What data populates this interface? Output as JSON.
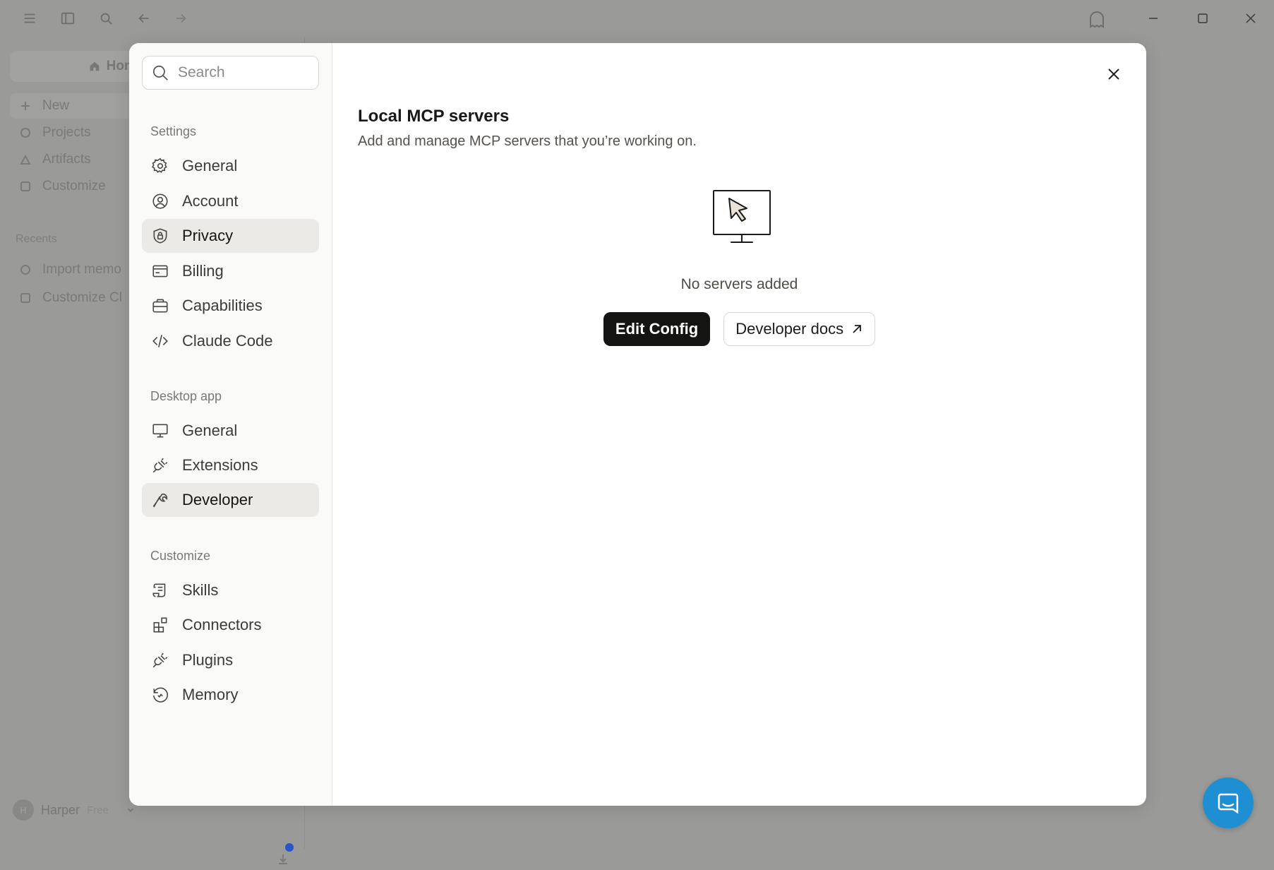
{
  "background": {
    "sidebar": {
      "home_label": "Home",
      "items": [
        {
          "label": "New",
          "icon": "plus-icon"
        },
        {
          "label": "Projects",
          "icon": "folder-icon"
        },
        {
          "label": "Artifacts",
          "icon": "artifacts-icon"
        },
        {
          "label": "Customize",
          "icon": "customize-icon"
        }
      ],
      "recents_label": "Recents",
      "recents": [
        {
          "label": "Import memo",
          "icon": "chat-icon"
        },
        {
          "label": "Customize Cl",
          "icon": "chat-icon"
        }
      ],
      "user": {
        "initial": "H",
        "name": "Harper",
        "plan": "Free"
      }
    }
  },
  "settings": {
    "search": {
      "placeholder": "Search"
    },
    "groups": [
      {
        "label": "Settings",
        "items": [
          {
            "label": "General",
            "icon": "gear-icon",
            "active": false
          },
          {
            "label": "Account",
            "icon": "user-circle-icon",
            "active": false
          },
          {
            "label": "Privacy",
            "icon": "shield-lock-icon",
            "active": false
          },
          {
            "label": "Billing",
            "icon": "credit-card-icon",
            "active": false
          },
          {
            "label": "Capabilities",
            "icon": "briefcase-icon",
            "active": false
          },
          {
            "label": "Claude Code",
            "icon": "code-icon",
            "active": false
          }
        ]
      },
      {
        "label": "Desktop app",
        "items": [
          {
            "label": "General",
            "icon": "monitor-icon",
            "active": false
          },
          {
            "label": "Extensions",
            "icon": "plug-icon",
            "active": false
          },
          {
            "label": "Developer",
            "icon": "wrench-icon",
            "active": true
          }
        ]
      },
      {
        "label": "Customize",
        "items": [
          {
            "label": "Skills",
            "icon": "scroll-icon",
            "active": false
          },
          {
            "label": "Connectors",
            "icon": "grid-plus-icon",
            "active": false
          },
          {
            "label": "Plugins",
            "icon": "plug-icon",
            "active": false
          },
          {
            "label": "Memory",
            "icon": "memory-icon",
            "active": false
          }
        ]
      }
    ],
    "content": {
      "title": "Local MCP servers",
      "subtitle": "Add and manage MCP servers that you’re working on.",
      "empty_state": "No servers added",
      "primary_button": "Edit Config",
      "secondary_button": "Developer docs"
    }
  }
}
